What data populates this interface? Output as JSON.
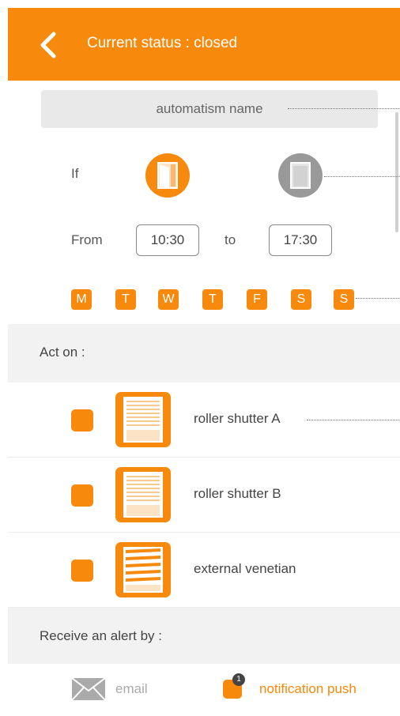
{
  "header": {
    "title": "Current status : closed",
    "color": "#f7890c",
    "back_icon": "chevron-left-icon"
  },
  "automatism": {
    "name": "automatism name"
  },
  "condition": {
    "if_label": "If",
    "state_open_icon": "door-open-icon",
    "state_closed_icon": "door-closed-icon",
    "from_label": "From",
    "from_time": "10:30",
    "to_label": "to",
    "to_time": "17:30"
  },
  "days": [
    "M",
    "T",
    "W",
    "T",
    "F",
    "S",
    "S"
  ],
  "act_on": {
    "label": "Act on :",
    "devices": [
      {
        "name": "roller shutter A",
        "icon": "roller-shutter-icon"
      },
      {
        "name": "roller shutter B",
        "icon": "roller-shutter-icon"
      },
      {
        "name": "external venetian",
        "icon": "venetian-blind-icon"
      }
    ]
  },
  "alert": {
    "label": "Receive an alert by :",
    "email_label": "email",
    "push_label": "notification push",
    "push_badge": "1",
    "accent": "#f7890c",
    "inactive": "#aaaaaa"
  }
}
